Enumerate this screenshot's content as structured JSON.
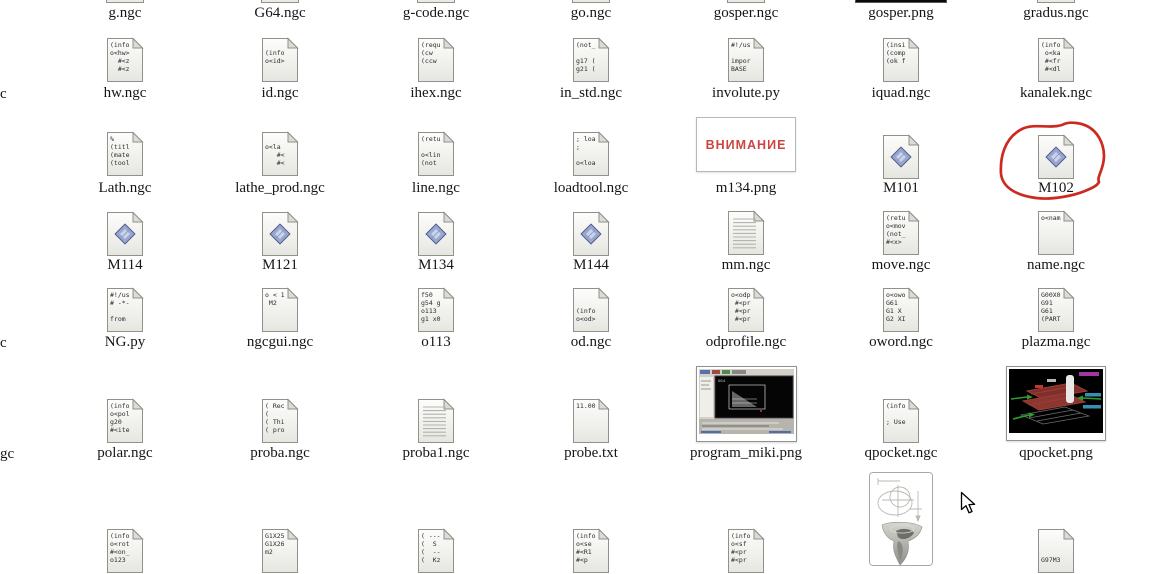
{
  "desktop": {
    "background_color": "#ffffff",
    "annotation_color": "#cc2a20",
    "warning_text_color": "#cd4540",
    "diamond_emblem_color": "#98a7cf"
  },
  "edge_fragments": [
    {
      "text": "c"
    },
    {
      "text": "c"
    },
    {
      "text": "gc"
    }
  ],
  "rows": [
    {
      "items": [
        {
          "type": "cut",
          "label": "g.ngc"
        },
        {
          "type": "cut",
          "label": "G64.ngc"
        },
        {
          "type": "cut",
          "label": "g-code.ngc"
        },
        {
          "type": "cut",
          "label": "go.ngc"
        },
        {
          "type": "cut",
          "label": "gosper.ngc"
        },
        {
          "type": "cut-dark",
          "label": "gosper.png"
        },
        {
          "type": "cut",
          "label": "gradus.ngc"
        }
      ]
    },
    {
      "items": [
        {
          "type": "code",
          "label": "hw.ngc",
          "lines": [
            "(info",
            "o<hw>",
            "  #<z",
            "  #<z"
          ]
        },
        {
          "type": "code",
          "label": "id.ngc",
          "lines": [
            "",
            "(info",
            "o<id>"
          ]
        },
        {
          "type": "code",
          "label": "ihex.ngc",
          "lines": [
            "(requ",
            "(cw",
            "(ccw"
          ]
        },
        {
          "type": "code",
          "label": "in_std.ngc",
          "lines": [
            "(not_",
            "",
            "g17 (",
            "g21 ("
          ]
        },
        {
          "type": "code",
          "label": "involute.py",
          "lines": [
            "#!/us",
            "",
            "impor",
            "BASE"
          ]
        },
        {
          "type": "code",
          "label": "iquad.ngc",
          "lines": [
            "(insi",
            "(comp",
            "(ok f"
          ]
        },
        {
          "type": "code",
          "label": "kanalek.ngc",
          "lines": [
            "(info",
            " o<ka",
            " #<fr",
            " #<dl"
          ]
        }
      ]
    },
    {
      "items": [
        {
          "type": "code",
          "label": "Lath.ngc",
          "lines": [
            "%",
            "(titl",
            "(mate",
            "(tool"
          ]
        },
        {
          "type": "code",
          "label": "lathe_prod.ngc",
          "lines": [
            "",
            "o<la",
            "   #<",
            "   #<"
          ]
        },
        {
          "type": "code",
          "label": "line.ngc",
          "lines": [
            "(retu",
            "",
            "o<lin",
            "(not"
          ]
        },
        {
          "type": "code",
          "label": "loadtool.ngc",
          "lines": [
            "; loa",
            ";",
            "",
            "o<loa"
          ]
        },
        {
          "type": "image-vnimanie",
          "label": "m134.png",
          "text": "ВНИМАНИЕ"
        },
        {
          "type": "diamond",
          "label": "M101"
        },
        {
          "type": "diamond",
          "label": "M102",
          "annotated": true
        }
      ]
    },
    {
      "items": [
        {
          "type": "diamond",
          "label": "M114"
        },
        {
          "type": "diamond",
          "label": "M121"
        },
        {
          "type": "diamond",
          "label": "M134"
        },
        {
          "type": "diamond",
          "label": "M144"
        },
        {
          "type": "ruled",
          "label": "mm.ngc"
        },
        {
          "type": "code",
          "label": "move.ngc",
          "lines": [
            "(retu",
            "o<mov",
            "(not_",
            "#<x>"
          ]
        },
        {
          "type": "code",
          "label": "name.ngc",
          "lines": [
            "o<nam"
          ]
        }
      ]
    },
    {
      "items": [
        {
          "type": "code",
          "label": "NG.py",
          "lines": [
            "#!/us",
            "# -*-",
            "",
            "from"
          ]
        },
        {
          "type": "code",
          "label": "ngcgui.ngc",
          "lines": [
            "o < 1",
            " M2"
          ]
        },
        {
          "type": "code",
          "label": "o113",
          "lines": [
            "f50",
            "g54 g",
            "o113",
            "g1 x0"
          ]
        },
        {
          "type": "code",
          "label": "od.ngc",
          "lines": [
            "",
            "",
            "(info",
            "o<od>"
          ]
        },
        {
          "type": "code",
          "label": "odprofile.ngc",
          "lines": [
            "o<odp",
            " #<pr",
            " #<pr",
            " #<pr"
          ]
        },
        {
          "type": "code",
          "label": "oword.ngc",
          "lines": [
            "o<owo",
            "G61",
            "G1 X",
            "G2 XI"
          ]
        },
        {
          "type": "code",
          "label": "plazma.ngc",
          "lines": [
            "G00X0",
            "G91",
            "G61",
            "(PART"
          ]
        }
      ]
    },
    {
      "items": [
        {
          "type": "code",
          "label": "polar.ngc",
          "lines": [
            "(info",
            "o<pol",
            "g20",
            "#<ite"
          ]
        },
        {
          "type": "code",
          "label": "proba.ngc",
          "lines": [
            "( Rec",
            "(",
            "( Thi",
            "( pro"
          ]
        },
        {
          "type": "ruled",
          "label": "proba1.ngc"
        },
        {
          "type": "code",
          "label": "probe.txt",
          "lines": [
            "11.00"
          ]
        },
        {
          "type": "image-app",
          "label": "program_miki.png"
        },
        {
          "type": "code",
          "label": "qpocket.ngc",
          "lines": [
            "(info",
            "",
            "; Use"
          ]
        },
        {
          "type": "image-3d",
          "label": "qpocket.png"
        }
      ]
    },
    {
      "items": [
        {
          "type": "code",
          "label": "",
          "lines": [
            "(info",
            "o<rot",
            "#<on_",
            "o123"
          ]
        },
        {
          "type": "code",
          "label": "",
          "lines": [
            "G1X25",
            "G1X26",
            "m2"
          ]
        },
        {
          "type": "code",
          "label": "",
          "lines": [
            "( ---",
            "(  S",
            "(  --",
            "(  Kz"
          ]
        },
        {
          "type": "code",
          "label": "",
          "lines": [
            "(info",
            "o<se",
            "#<R1",
            "#<p"
          ]
        },
        {
          "type": "code",
          "label": "",
          "lines": [
            "(info",
            "o<sf",
            "#<pr",
            "#<pr"
          ]
        },
        {
          "type": "image-drawing",
          "label": ""
        },
        {
          "type": "code",
          "label": "",
          "lines": [
            "",
            "",
            "",
            "G97M3"
          ]
        }
      ]
    }
  ]
}
